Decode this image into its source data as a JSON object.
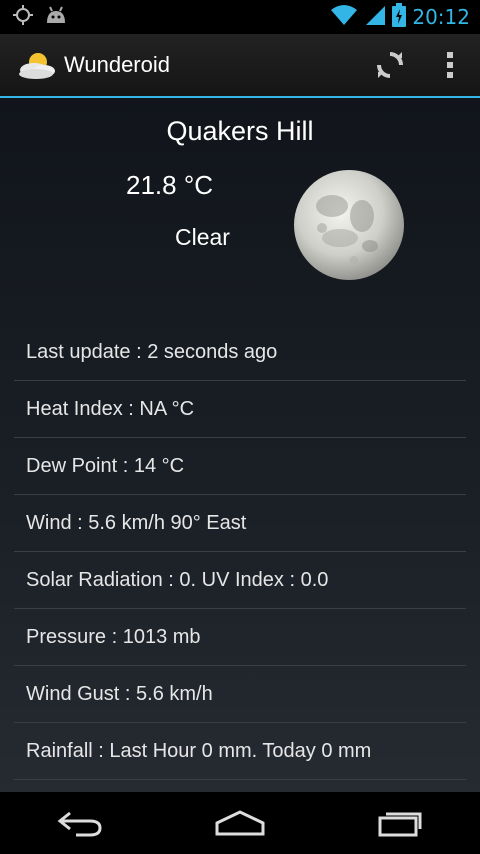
{
  "status_bar": {
    "time": "20:12",
    "icons": [
      "gps-icon",
      "android-debug-icon",
      "wifi-icon",
      "cell-signal-icon",
      "battery-charging-icon"
    ],
    "accent_color": "#33b5e5"
  },
  "action_bar": {
    "title": "Wunderoid",
    "app_icon": "partly-cloudy-icon",
    "actions": [
      "refresh-icon",
      "overflow-menu-icon"
    ]
  },
  "weather": {
    "city": "Quakers Hill",
    "temperature": "21.8 °C",
    "condition": "Clear",
    "condition_icon": "moon-icon"
  },
  "details": [
    "Last update :  2 seconds ago",
    "Heat Index : NA °C",
    "Dew Point : 14 °C",
    "Wind : 5.6 km/h 90° East",
    "Solar Radiation : 0. UV Index : 0.0",
    "Pressure : 1013 mb",
    "Wind Gust : 5.6 km/h",
    "Rainfall : Last Hour 0 mm. Today 0 mm"
  ],
  "nav_bar": [
    "back-icon",
    "home-icon",
    "recent-apps-icon"
  ]
}
